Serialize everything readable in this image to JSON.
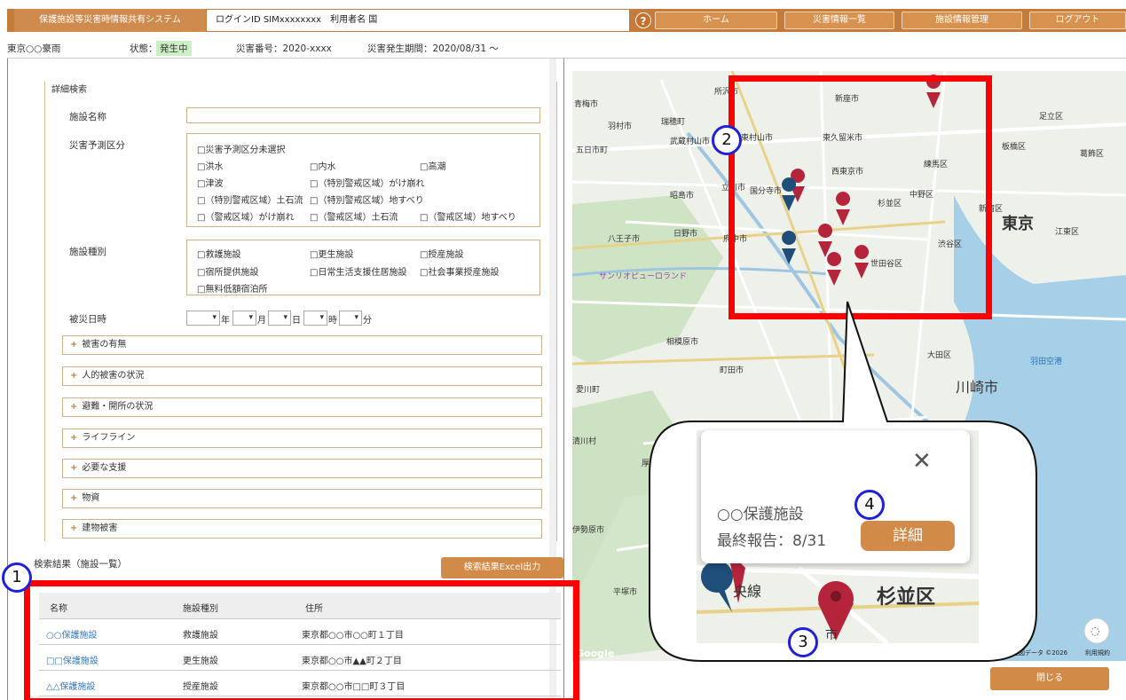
{
  "header": {
    "app_title": "保護施設等災害時情報共有システム",
    "login_info": "ログインID SIMxxxxxxxx　利用者名 国",
    "help": "?",
    "nav": [
      "ホーム",
      "災害情報一覧",
      "施設情報管理",
      "ログアウト"
    ]
  },
  "status_bar": {
    "disaster_name": "東京○○豪雨",
    "state_label": "状態：",
    "state_value": "発生中",
    "disaster_no": "災害番号：2020-xxxx",
    "period": "災害発生期間：2020/08/31 ～"
  },
  "search": {
    "title": "詳細検索",
    "facility_name_label": "施設名称",
    "forecast_label": "災害予測区分",
    "forecast_options": [
      "□災害予測区分未選択",
      "□洪水",
      "□内水",
      "□高潮",
      "□津波",
      "□（特別警戒区域）がけ崩れ",
      "□（特別警戒区域）土石流",
      "□（特別警戒区域）地すべり",
      "□（警戒区域）がけ崩れ",
      "□（警戒区域）土石流",
      "□（警戒区域）地すべり"
    ],
    "facility_type_label": "施設種別",
    "facility_type_options": [
      "□救護施設",
      "□更生施設",
      "□授産施設",
      "□宿所提供施設",
      "□日常生活支援住居施設",
      "□社会事業授産施設",
      "□無料低額宿泊所"
    ],
    "date_label": "被災日時",
    "date_units": [
      "年",
      "月",
      "日",
      "時",
      "分"
    ],
    "accordions": [
      "被害の有無",
      "人的被害の状況",
      "避難・開所の状況",
      "ライフライン",
      "必要な支援",
      "物資",
      "建物被害"
    ]
  },
  "results": {
    "title": "検索結果（施設一覧）",
    "excel_button": "検索結果Excel出力",
    "columns": [
      "名称",
      "施設種別",
      "住所"
    ],
    "rows": [
      {
        "name": "○○保護施設",
        "type": "救護施設",
        "address": "東京都○○市○○町１丁目"
      },
      {
        "name": "□□保護施設",
        "type": "更生施設",
        "address": "東京都○○市▲▲町２丁目"
      },
      {
        "name": "△△保護施設",
        "type": "授産施設",
        "address": "東京都○○市□□町３丁目"
      }
    ]
  },
  "map": {
    "place_labels": [
      "青梅市",
      "所沢市",
      "新座市",
      "足立区",
      "羽村市",
      "瑞穂町",
      "東村山市",
      "東久留米市",
      "板橋区",
      "葛飾区",
      "武蔵村山市",
      "西東京市",
      "練馬区",
      "五日市町",
      "昭島市",
      "立川市",
      "国分寺市",
      "中野区",
      "新宿区",
      "杉並区",
      "東京",
      "江東区",
      "八王子市",
      "日野市",
      "府中市",
      "渋谷区",
      "世田谷区",
      "サンリオピューロランド",
      "相模原市",
      "大田区",
      "羽田空港",
      "町田市",
      "川崎市",
      "愛川町",
      "清川村",
      "厚木市",
      "伊勢原市",
      "平塚市"
    ],
    "attribution": "Google",
    "map_data": "地図データ ©2026",
    "terms": "利用規約",
    "close_button": "閉じる"
  },
  "popup": {
    "name": "○○保護施設",
    "last_report": "最終報告：8/31",
    "detail_button": "詳細",
    "close": "✕",
    "zoom_labels": [
      "央線",
      "杉並区"
    ],
    "zoom_label_extra": "市"
  },
  "callouts": [
    "1",
    "2",
    "3",
    "4"
  ],
  "colors": {
    "accent": "#c57b3b",
    "highlight": "#ff0000",
    "callout_border": "#1f1fdc",
    "pin_red": "#b5243a",
    "pin_blue": "#1f4e7a"
  }
}
